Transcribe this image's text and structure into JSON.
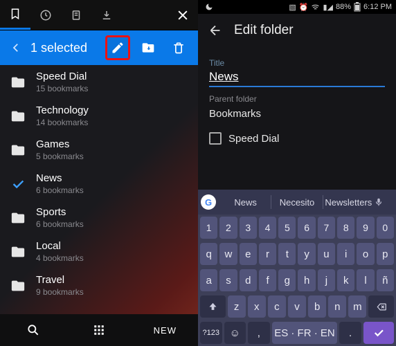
{
  "left": {
    "selection_text": "1 selected",
    "folders": [
      {
        "name": "Speed Dial",
        "sub": "15 bookmarks",
        "selected": false
      },
      {
        "name": "Technology",
        "sub": "14 bookmarks",
        "selected": false
      },
      {
        "name": "Games",
        "sub": "5 bookmarks",
        "selected": false
      },
      {
        "name": "News",
        "sub": "6 bookmarks",
        "selected": true
      },
      {
        "name": "Sports",
        "sub": "6 bookmarks",
        "selected": false
      },
      {
        "name": "Local",
        "sub": "4 bookmarks",
        "selected": false
      },
      {
        "name": "Travel",
        "sub": "9 bookmarks",
        "selected": false
      }
    ],
    "new_label": "NEW"
  },
  "right": {
    "status": {
      "battery": "88%",
      "time": "6:12 PM"
    },
    "header": "Edit folder",
    "title_label": "Title",
    "title_value": "News",
    "parent_label": "Parent folder",
    "parent_value": "Bookmarks",
    "speeddial_label": "Speed Dial",
    "suggestions": [
      "News",
      "Necesito",
      "Newsletters"
    ],
    "space_label": "ES · FR · EN",
    "sym_label": "?123",
    "rows": {
      "num": [
        "1",
        "2",
        "3",
        "4",
        "5",
        "6",
        "7",
        "8",
        "9",
        "0"
      ],
      "r1": [
        "q",
        "w",
        "e",
        "r",
        "t",
        "y",
        "u",
        "i",
        "o",
        "p"
      ],
      "r2": [
        "a",
        "s",
        "d",
        "f",
        "g",
        "h",
        "j",
        "k",
        "l",
        "ñ"
      ],
      "r3": [
        "z",
        "x",
        "c",
        "v",
        "b",
        "n",
        "m"
      ]
    }
  }
}
